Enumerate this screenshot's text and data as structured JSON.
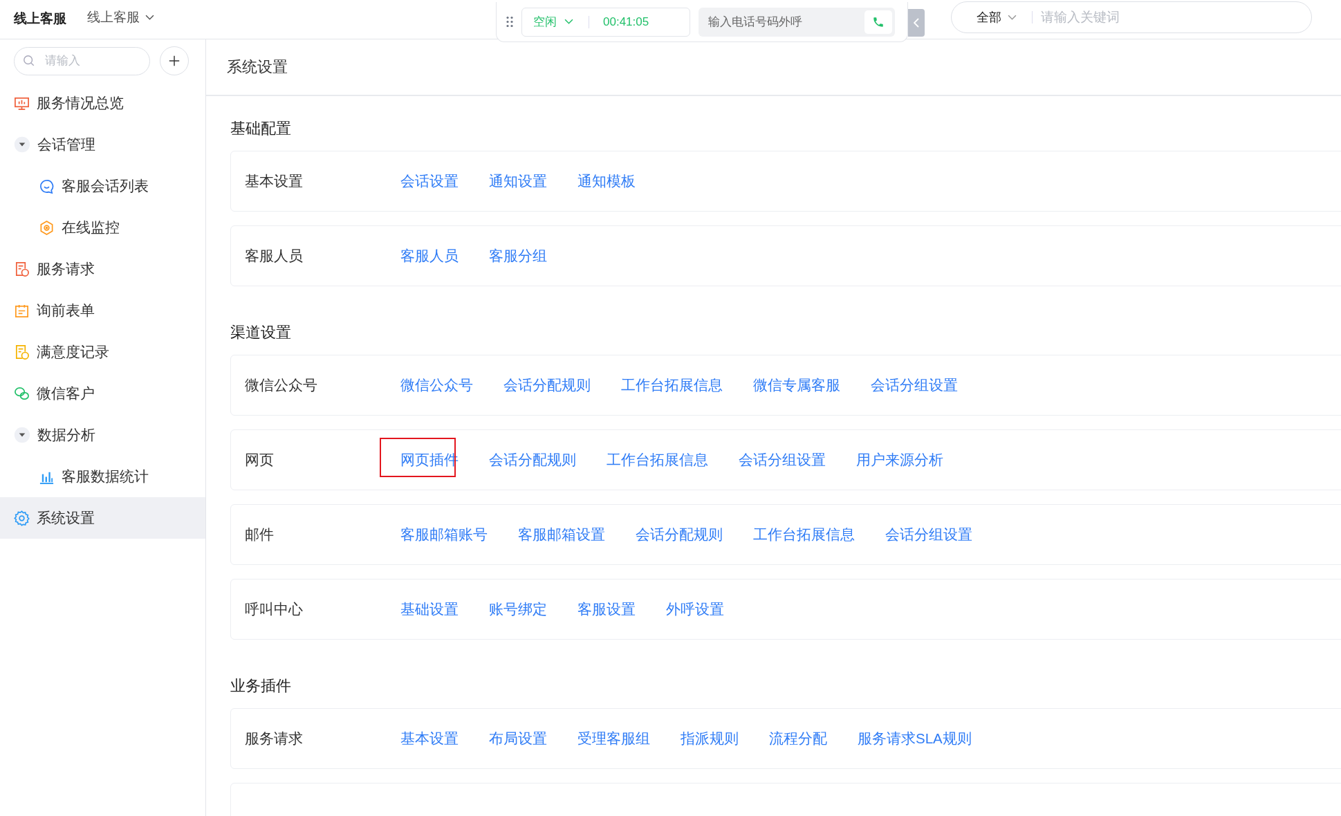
{
  "header": {
    "title": "线上客服",
    "workspace": "线上客服"
  },
  "call_bar": {
    "status": "空闲",
    "timer": "00:41:05",
    "phone_placeholder": "输入电话号码外呼"
  },
  "search": {
    "scope": "全部",
    "placeholder": "请输入关键词"
  },
  "sidebar": {
    "search_placeholder": "请输入",
    "items": [
      {
        "kind": "link",
        "label": "服务情况总览",
        "selected": false
      },
      {
        "kind": "group",
        "label": "会话管理",
        "selected": false,
        "expanded": true,
        "children": [
          {
            "kind": "link",
            "label": "客服会话列表",
            "selected": false
          },
          {
            "kind": "link",
            "label": "在线监控",
            "selected": false
          }
        ]
      },
      {
        "kind": "link",
        "label": "服务请求",
        "selected": false
      },
      {
        "kind": "link",
        "label": "询前表单",
        "selected": false
      },
      {
        "kind": "link",
        "label": "满意度记录",
        "selected": false
      },
      {
        "kind": "link",
        "label": "微信客户",
        "selected": false
      },
      {
        "kind": "group",
        "label": "数据分析",
        "selected": false,
        "expanded": true,
        "children": [
          {
            "kind": "link",
            "label": "客服数据统计",
            "selected": false
          }
        ]
      },
      {
        "kind": "link",
        "label": "系统设置",
        "selected": true
      }
    ]
  },
  "page_title": "系统设置",
  "sections": [
    {
      "title": "基础配置",
      "rows": [
        {
          "label": "基本设置",
          "links": [
            {
              "text": "会话设置",
              "highlighted": false
            },
            {
              "text": "通知设置",
              "highlighted": false
            },
            {
              "text": "通知模板",
              "highlighted": false
            }
          ]
        },
        {
          "label": "客服人员",
          "links": [
            {
              "text": "客服人员",
              "highlighted": false
            },
            {
              "text": "客服分组",
              "highlighted": false
            }
          ]
        }
      ]
    },
    {
      "title": "渠道设置",
      "rows": [
        {
          "label": "微信公众号",
          "links": [
            {
              "text": "微信公众号",
              "highlighted": false
            },
            {
              "text": "会话分配规则",
              "highlighted": false
            },
            {
              "text": "工作台拓展信息",
              "highlighted": false
            },
            {
              "text": "微信专属客服",
              "highlighted": false
            },
            {
              "text": "会话分组设置",
              "highlighted": false
            }
          ]
        },
        {
          "label": "网页",
          "links": [
            {
              "text": "网页插件",
              "highlighted": true
            },
            {
              "text": "会话分配规则",
              "highlighted": false
            },
            {
              "text": "工作台拓展信息",
              "highlighted": false
            },
            {
              "text": "会话分组设置",
              "highlighted": false
            },
            {
              "text": "用户来源分析",
              "highlighted": false
            }
          ]
        },
        {
          "label": "邮件",
          "links": [
            {
              "text": "客服邮箱账号",
              "highlighted": false
            },
            {
              "text": "客服邮箱设置",
              "highlighted": false
            },
            {
              "text": "会话分配规则",
              "highlighted": false
            },
            {
              "text": "工作台拓展信息",
              "highlighted": false
            },
            {
              "text": "会话分组设置",
              "highlighted": false
            }
          ]
        },
        {
          "label": "呼叫中心",
          "links": [
            {
              "text": "基础设置",
              "highlighted": false
            },
            {
              "text": "账号绑定",
              "highlighted": false
            },
            {
              "text": "客服设置",
              "highlighted": false
            },
            {
              "text": "外呼设置",
              "highlighted": false
            }
          ]
        }
      ]
    },
    {
      "title": "业务插件",
      "rows": [
        {
          "label": "服务请求",
          "links": [
            {
              "text": "基本设置",
              "highlighted": false
            },
            {
              "text": "布局设置",
              "highlighted": false
            },
            {
              "text": "受理客服组",
              "highlighted": false
            },
            {
              "text": "指派规则",
              "highlighted": false
            },
            {
              "text": "流程分配",
              "highlighted": false
            },
            {
              "text": "服务请求SLA规则",
              "highlighted": false
            }
          ]
        }
      ]
    }
  ]
}
